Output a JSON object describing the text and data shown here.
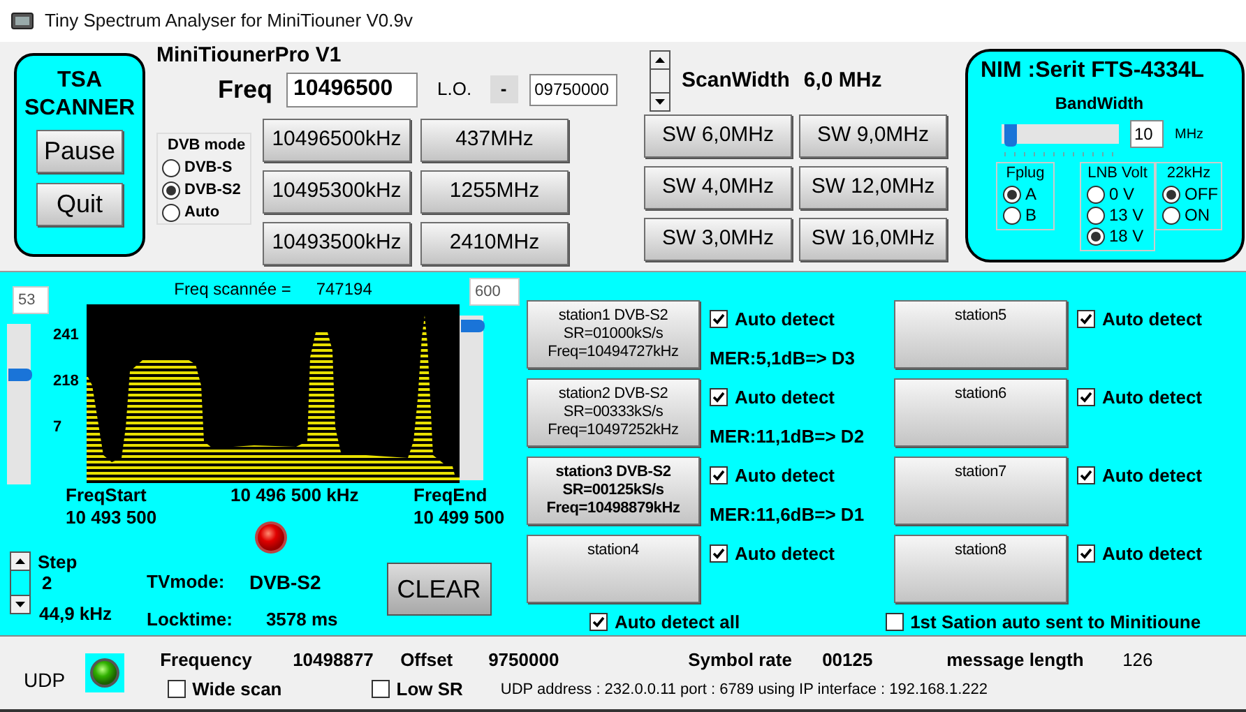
{
  "window": {
    "title": "Tiny Spectrum Analyser for MiniTiouner V0.9v"
  },
  "scanner": {
    "title": "TSA SCANNER",
    "buttons": [
      "Pause",
      "Quit"
    ]
  },
  "device": "MiniTiounerPro V1",
  "freq": {
    "label": "Freq",
    "value": "10496500"
  },
  "lo": {
    "label": "L.O.",
    "sign": "-",
    "value": "09750000"
  },
  "dvb_mode": {
    "title": "DVB mode",
    "options": [
      {
        "label": "DVB-S",
        "selected": false
      },
      {
        "label": "DVB-S2",
        "selected": true
      },
      {
        "label": "Auto",
        "selected": false
      }
    ]
  },
  "preset_buttons": [
    "10496500kHz",
    "437MHz",
    "10495300kHz",
    "1255MHz",
    "10493500kHz",
    "2410MHz"
  ],
  "scan_width": {
    "label": "ScanWidth",
    "value": "6,0 MHz"
  },
  "sw_buttons": [
    "SW 6,0MHz",
    "SW 9,0MHz",
    "SW 4,0MHz",
    "SW 12,0MHz",
    "SW 3,0MHz",
    "SW 16,0MHz"
  ],
  "nim": {
    "title": "NIM :Serit FTS-4334L",
    "bandwidth": {
      "label": "BandWidth",
      "level": 0.03,
      "value": "10",
      "unit": "MHz"
    },
    "groups": [
      {
        "title": "Fplug",
        "options": [
          {
            "label": "A",
            "selected": true
          },
          {
            "label": "B",
            "selected": false
          }
        ]
      },
      {
        "title": "LNB Volt",
        "options": [
          {
            "label": "0 V",
            "selected": false
          },
          {
            "label": "13 V",
            "selected": false
          },
          {
            "label": "18 V",
            "selected": true
          }
        ]
      },
      {
        "title": "22kHz",
        "options": [
          {
            "label": "OFF",
            "selected": true
          },
          {
            "label": "ON",
            "selected": false
          }
        ]
      }
    ]
  },
  "spectrum": {
    "scan_label": "Freq scannée =",
    "scan_value": "747194",
    "left_slider": {
      "value": "53",
      "level": 0.7
    },
    "right_slider": {
      "value": "600",
      "level": 0.97
    },
    "y_labels": [
      "241",
      "218",
      "7"
    ],
    "freq_start": {
      "label": "FreqStart",
      "value": "10 493 500"
    },
    "center": "10 496 500 kHz",
    "freq_end": {
      "label": "FreqEnd",
      "value": "10 499 500"
    }
  },
  "step": {
    "label": "Step",
    "value": "2",
    "khz": "44,9 kHz"
  },
  "tvmode": {
    "label": "TVmode:",
    "value": "DVB-S2"
  },
  "locktime": {
    "label": "Locktime:",
    "value": "3578 ms"
  },
  "clear_button": "CLEAR",
  "stations": [
    {
      "lines": [
        "station1 DVB-S2",
        "SR=01000kS/s",
        "Freq=10494727kHz"
      ],
      "selected": false,
      "auto_detect": {
        "label": "Auto detect",
        "checked": true
      },
      "mer": "MER:5,1dB=> D3"
    },
    {
      "lines": [
        "station2 DVB-S2",
        "SR=00333kS/s",
        "Freq=10497252kHz"
      ],
      "selected": false,
      "auto_detect": {
        "label": "Auto detect",
        "checked": true
      },
      "mer": "MER:11,1dB=> D2"
    },
    {
      "lines": [
        "station3 DVB-S2",
        "SR=00125kS/s",
        "Freq=10498879kHz"
      ],
      "selected": true,
      "auto_detect": {
        "label": "Auto detect",
        "checked": true
      },
      "mer": "MER:11,6dB=> D1"
    },
    {
      "lines": [
        "station4"
      ],
      "selected": false,
      "auto_detect": {
        "label": "Auto detect",
        "checked": true
      }
    },
    {
      "lines": [
        "station5"
      ],
      "selected": false,
      "auto_detect": {
        "label": "Auto detect",
        "checked": true
      }
    },
    {
      "lines": [
        "station6"
      ],
      "selected": false,
      "auto_detect": {
        "label": "Auto detect",
        "checked": true
      }
    },
    {
      "lines": [
        "station7"
      ],
      "selected": false,
      "auto_detect": {
        "label": "Auto detect",
        "checked": true
      }
    },
    {
      "lines": [
        "station8"
      ],
      "selected": false,
      "auto_detect": {
        "label": "Auto detect",
        "checked": true
      }
    }
  ],
  "auto_detect_all": {
    "label": "Auto detect all",
    "checked": true
  },
  "first_station_auto": {
    "label": "1st Sation auto sent to Minitioune",
    "checked": false
  },
  "status_bar": {
    "udp_label": "UDP",
    "fields": [
      {
        "label": "Frequency",
        "value": "10498877"
      },
      {
        "label": "Offset",
        "value": "9750000"
      },
      {
        "label": "Symbol rate",
        "value": "00125"
      },
      {
        "label": "message length",
        "value": "126"
      }
    ],
    "wide_scan": {
      "label": "Wide scan",
      "checked": false
    },
    "low_sr": {
      "label": "Low SR",
      "checked": false
    },
    "udp_info": "UDP address : 232.0.0.11 port : 6789 using IP interface : 192.168.1.222"
  }
}
